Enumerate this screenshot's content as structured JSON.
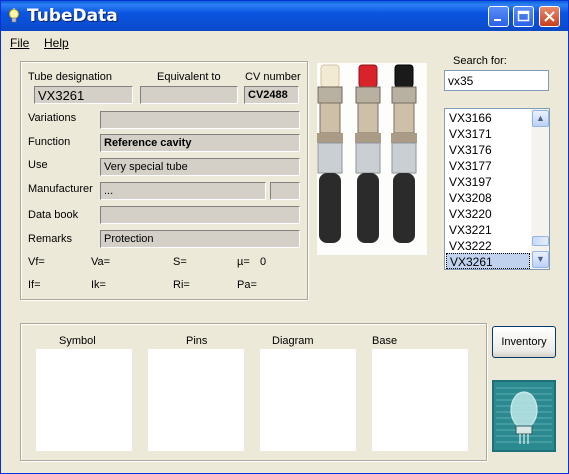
{
  "window": {
    "title": "TubeData"
  },
  "menu": [
    {
      "label": "File"
    },
    {
      "label": "Help"
    }
  ],
  "headers": {
    "designation": "Tube designation",
    "equivalent": "Equivalent to",
    "cv": "CV number"
  },
  "tube": {
    "designation": "VX3261",
    "equivalent": "",
    "cv": "CV2488",
    "variations": "",
    "function": "Reference cavity",
    "use": "Very special tube",
    "manufacturer": "...",
    "manufacturer_extra": "",
    "databook": "",
    "remarks": "Protection"
  },
  "labels": {
    "variations": "Variations",
    "function": "Function",
    "use": "Use",
    "manufacturer": "Manufacturer",
    "databook": "Data book",
    "remarks": "Remarks"
  },
  "params": {
    "vf": "Vf=",
    "va": "Va=",
    "s": "S=",
    "mu": "µ=",
    "mu_value": "0",
    "if": "If=",
    "ik": "Ik=",
    "ri": "Ri=",
    "pa": "Pa="
  },
  "search": {
    "label": "Search for:",
    "value": "vx35"
  },
  "list": {
    "items": [
      "VX3166",
      "VX3171",
      "VX3176",
      "VX3177",
      "VX3197",
      "VX3208",
      "VX3220",
      "VX3221",
      "VX3222",
      "VX3261"
    ],
    "selected": "VX3261"
  },
  "panels": {
    "symbol": "Symbol",
    "pins": "Pins",
    "diagram": "Diagram",
    "base": "Base"
  },
  "buttons": {
    "inventory": "Inventory"
  },
  "colors": {
    "titlebar": "#0a4fd4",
    "face": "#ece9d8",
    "selection": "#c1d2ee"
  }
}
